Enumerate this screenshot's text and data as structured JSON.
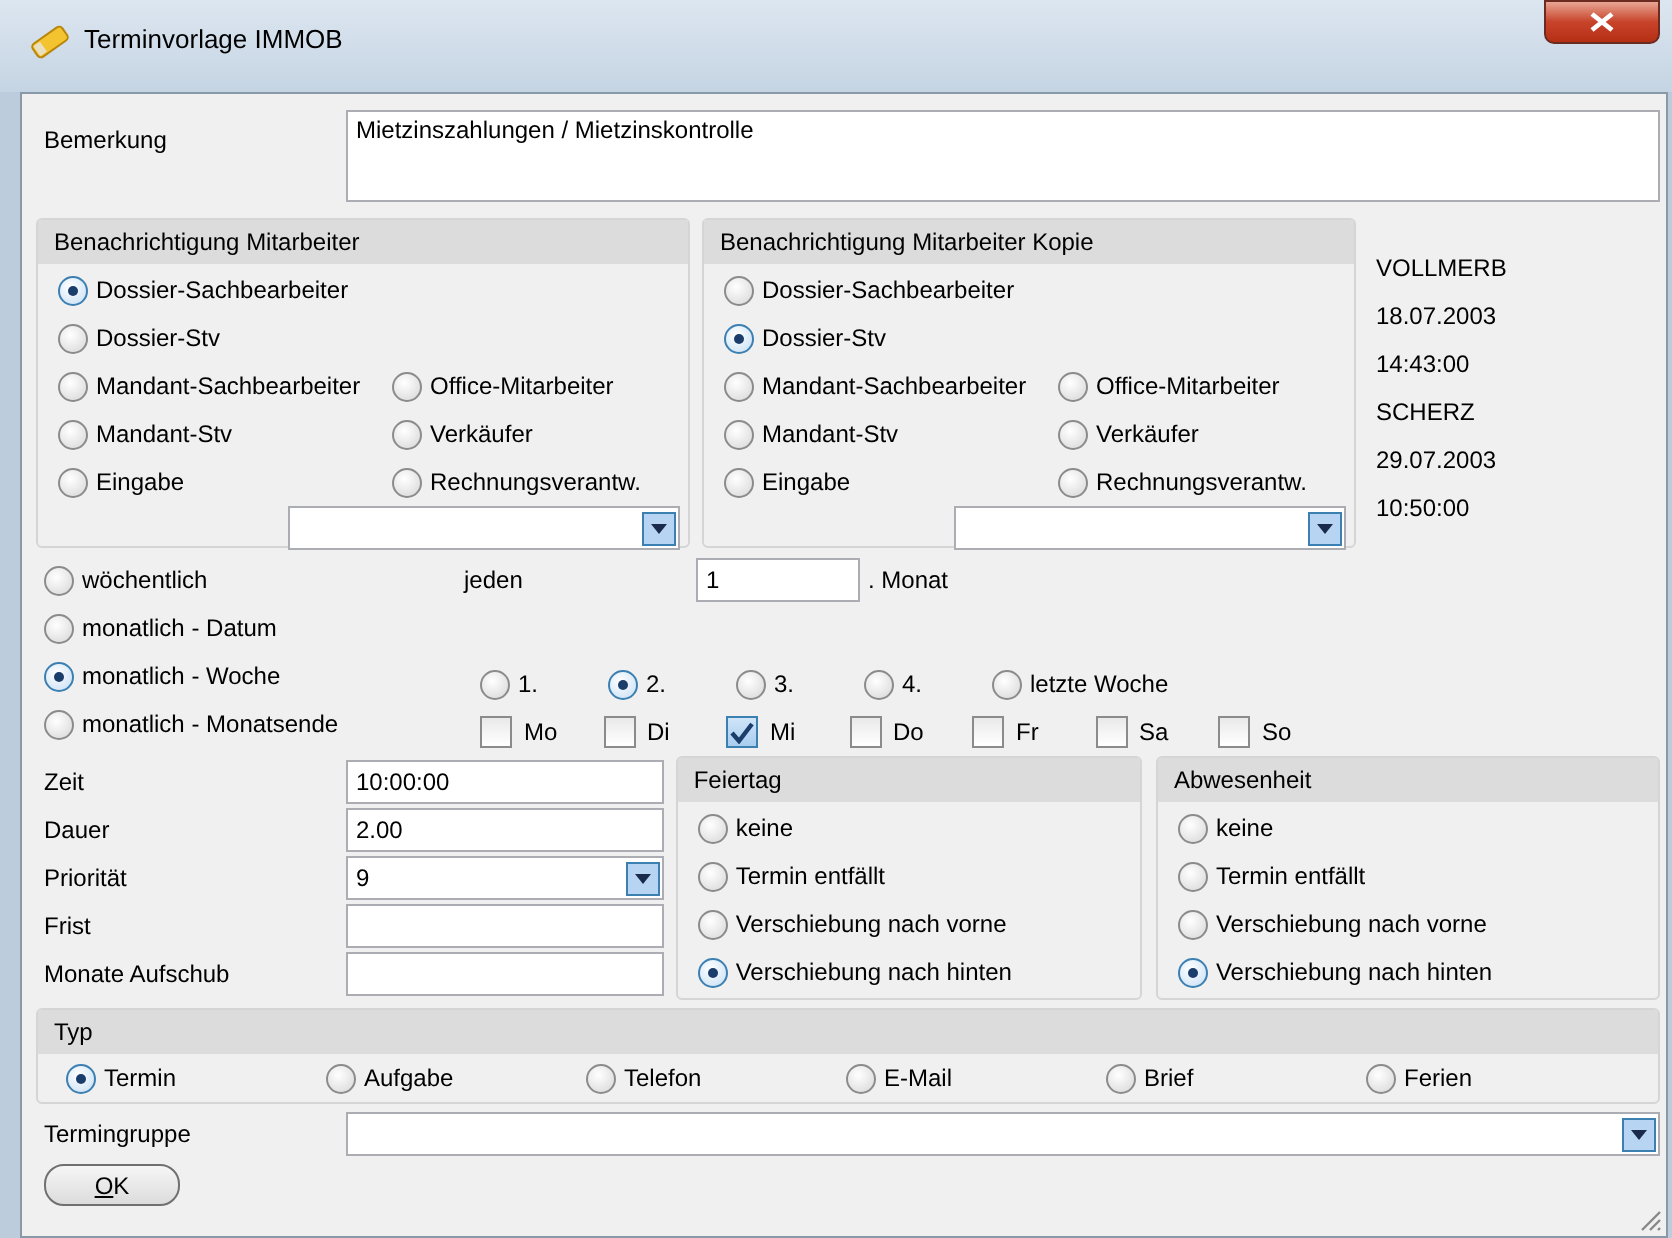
{
  "window": {
    "title": "Terminvorlage IMMOB"
  },
  "remark": {
    "label": "Bemerkung",
    "value": "Mietzinszahlungen / Mietzinskontrolle"
  },
  "notification_groups": [
    {
      "title": "Benachrichtigung Mitarbeiter",
      "options": [
        {
          "label": "Dossier-Sachbearbeiter",
          "selected": true
        },
        {
          "label": "Dossier-Stv",
          "selected": false
        },
        {
          "label": "Mandant-Sachbearbeiter",
          "selected": false
        },
        {
          "label": "Office-Mitarbeiter",
          "selected": false
        },
        {
          "label": "Mandant-Stv",
          "selected": false
        },
        {
          "label": "Verkäufer",
          "selected": false
        },
        {
          "label": "Eingabe",
          "selected": false
        },
        {
          "label": "Rechnungsverantw.",
          "selected": false
        }
      ]
    },
    {
      "title": "Benachrichtigung Mitarbeiter Kopie",
      "options": [
        {
          "label": "Dossier-Sachbearbeiter",
          "selected": false
        },
        {
          "label": "Dossier-Stv",
          "selected": true
        },
        {
          "label": "Mandant-Sachbearbeiter",
          "selected": false
        },
        {
          "label": "Office-Mitarbeiter",
          "selected": false
        },
        {
          "label": "Mandant-Stv",
          "selected": false
        },
        {
          "label": "Verkäufer",
          "selected": false
        },
        {
          "label": "Eingabe",
          "selected": false
        },
        {
          "label": "Rechnungsverantw.",
          "selected": false
        }
      ]
    }
  ],
  "audit": [
    "VOLLMERB",
    "18.07.2003",
    "14:43:00",
    "SCHERZ",
    "29.07.2003",
    "10:50:00"
  ],
  "recurrence": {
    "options": [
      {
        "label": "wöchentlich",
        "selected": false
      },
      {
        "label": "monatlich - Datum",
        "selected": false
      },
      {
        "label": "monatlich - Woche",
        "selected": true
      },
      {
        "label": "monatlich - Monatsende",
        "selected": false
      }
    ],
    "every_label": "jeden",
    "every_value": "1",
    "every_unit": ". Monat",
    "weeks": [
      {
        "label": "1.",
        "selected": false
      },
      {
        "label": "2.",
        "selected": true
      },
      {
        "label": "3.",
        "selected": false
      },
      {
        "label": "4.",
        "selected": false
      },
      {
        "label": "letzte Woche",
        "selected": false
      }
    ],
    "weekdays": [
      {
        "label": "Mo",
        "checked": false
      },
      {
        "label": "Di",
        "checked": false
      },
      {
        "label": "Mi",
        "checked": true
      },
      {
        "label": "Do",
        "checked": false
      },
      {
        "label": "Fr",
        "checked": false
      },
      {
        "label": "Sa",
        "checked": false
      },
      {
        "label": "So",
        "checked": false
      }
    ]
  },
  "fields": [
    {
      "label": "Zeit",
      "value": "10:00:00",
      "kind": "text"
    },
    {
      "label": "Dauer",
      "value": "2.00",
      "kind": "text"
    },
    {
      "label": "Priorität",
      "value": "9",
      "kind": "dropdown"
    },
    {
      "label": "Frist",
      "kind": "text"
    },
    {
      "label": "Monate Aufschub",
      "kind": "text"
    }
  ],
  "shift_groups": [
    {
      "title": "Feiertag",
      "options": [
        {
          "label": "keine",
          "selected": false
        },
        {
          "label": "Termin entfällt",
          "selected": false
        },
        {
          "label": "Verschiebung nach vorne",
          "selected": false
        },
        {
          "label": "Verschiebung nach hinten",
          "selected": true
        }
      ]
    },
    {
      "title": "Abwesenheit",
      "options": [
        {
          "label": "keine",
          "selected": false
        },
        {
          "label": "Termin entfällt",
          "selected": false
        },
        {
          "label": "Verschiebung nach vorne",
          "selected": false
        },
        {
          "label": "Verschiebung nach hinten",
          "selected": true
        }
      ]
    }
  ],
  "type_group": {
    "title": "Typ",
    "options": [
      {
        "label": "Termin",
        "selected": true
      },
      {
        "label": "Aufgabe",
        "selected": false
      },
      {
        "label": "Telefon",
        "selected": false
      },
      {
        "label": "E-Mail",
        "selected": false
      },
      {
        "label": "Brief",
        "selected": false
      },
      {
        "label": "Ferien",
        "selected": false
      }
    ]
  },
  "appointment_group": {
    "label": "Termingruppe"
  },
  "ok_button": {
    "label": "OK"
  }
}
